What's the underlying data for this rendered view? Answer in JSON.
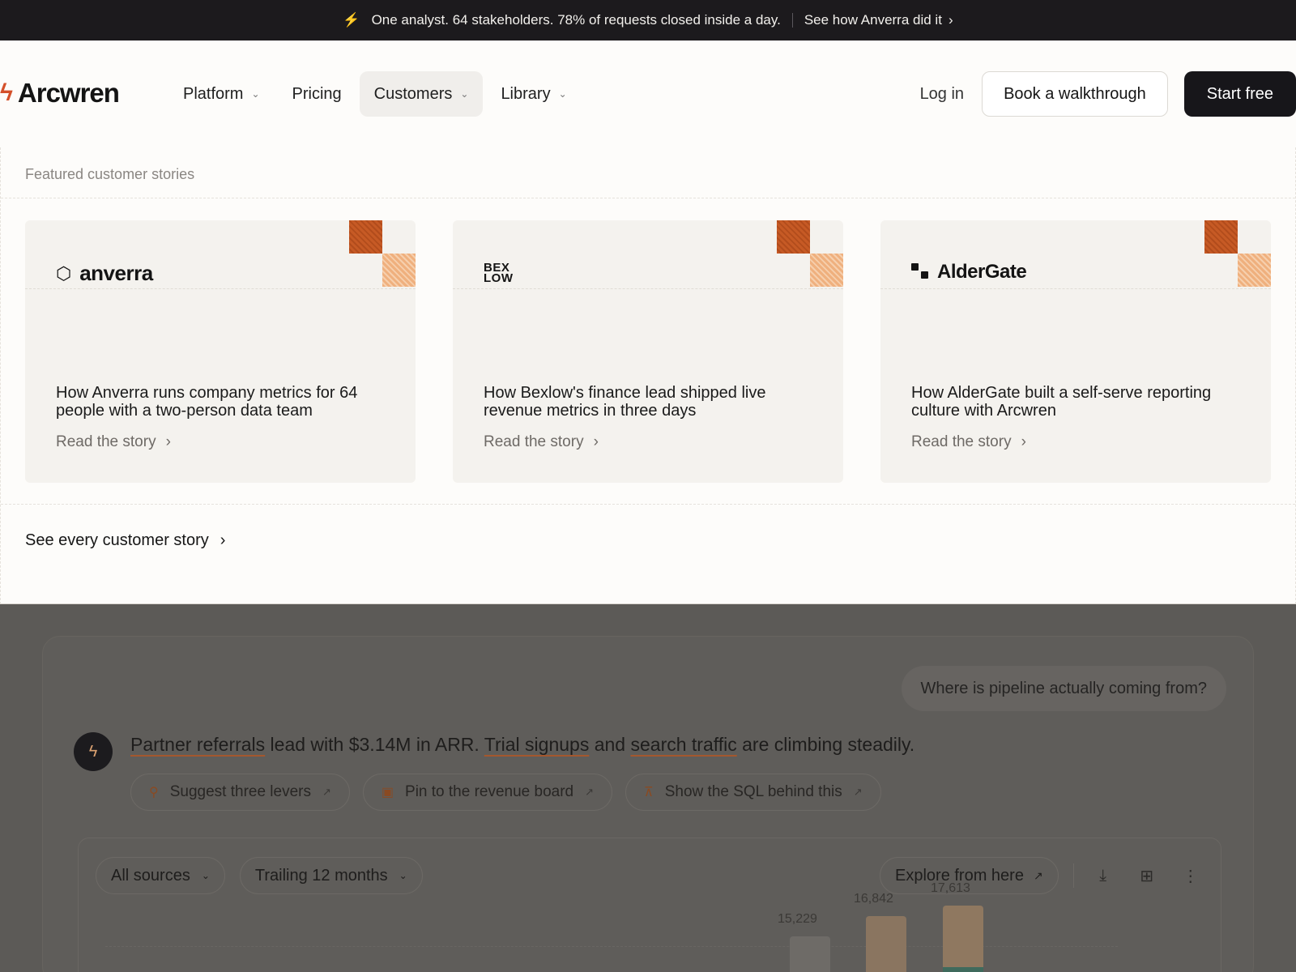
{
  "announcement": {
    "text": "One analyst. 64 stakeholders. 78% of requests closed inside a day.",
    "link": "See how Anverra did it"
  },
  "nav": {
    "brand": "Arcwren",
    "items": [
      {
        "label": "Platform",
        "has_menu": true
      },
      {
        "label": "Pricing",
        "has_menu": false
      },
      {
        "label": "Customers",
        "has_menu": true,
        "active": true
      },
      {
        "label": "Library",
        "has_menu": true
      }
    ],
    "login": "Log in",
    "walkthrough": "Book a walkthrough",
    "start": "Start free"
  },
  "stories": {
    "label": "Featured customer stories",
    "cards": [
      {
        "brand": "anverra",
        "title": "How Anverra runs company metrics for 64 people with a two-person data team",
        "cta": "Read the story"
      },
      {
        "brand_line1": "BEX",
        "brand_line2": "LOW",
        "title": "How Bexlow's finance lead shipped live revenue metrics in three days",
        "cta": "Read the story"
      },
      {
        "brand": "AlderGate",
        "title": "How AlderGate built a self-serve reporting culture with Arcwren",
        "cta": "Read the story"
      }
    ],
    "see_all": "See every customer story"
  },
  "demo": {
    "question": "Where is pipeline actually coming from?",
    "answer": {
      "p1": "Partner referrals",
      "p2": " lead with $3.14M in ARR. ",
      "p3": "Trial signups",
      "p4": " and ",
      "p5": "search traffic",
      "p6": " are climbing steadily."
    },
    "chips": [
      {
        "label": "Suggest three levers",
        "icon": "lightbulb-icon"
      },
      {
        "label": "Pin to the revenue board",
        "icon": "pin-board-icon"
      },
      {
        "label": "Show the SQL behind this",
        "icon": "sql-icon"
      }
    ],
    "filters": {
      "source": "All sources",
      "range": "Trailing 12 months"
    },
    "explore": "Explore from here"
  },
  "chart_data": {
    "type": "bar",
    "values": [
      15229,
      16842,
      17613
    ],
    "data_labels": [
      "15,229",
      "16,842",
      "17,613"
    ]
  },
  "colors": {
    "accent": "#d4502a",
    "dark": "#17161a",
    "overlay": "#5c5a57"
  }
}
